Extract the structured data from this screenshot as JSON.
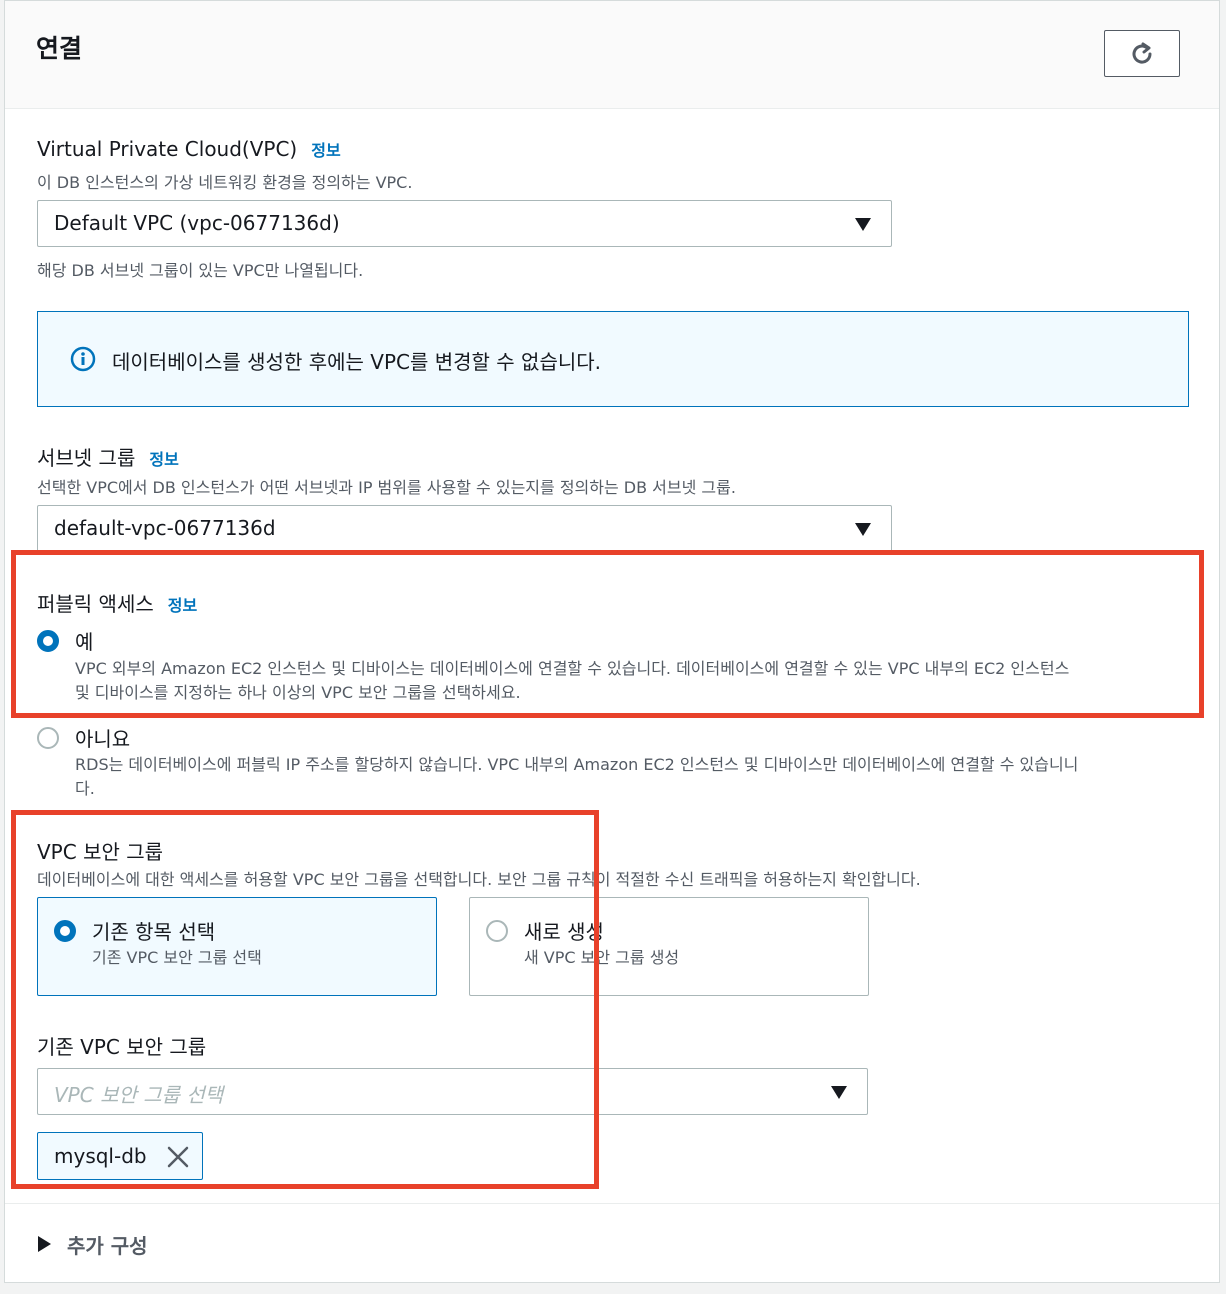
{
  "header": {
    "title": "연결"
  },
  "vpc": {
    "label": "Virtual Private Cloud(VPC)",
    "info": "정보",
    "description": "이 DB 인스턴스의 가상 네트워킹 환경을 정의하는 VPC.",
    "value": "Default VPC (vpc-0677136d)",
    "hint": "해당 DB 서브넷 그룹이 있는 VPC만 나열됩니다."
  },
  "alert": {
    "text": "데이터베이스를 생성한 후에는 VPC를 변경할 수 없습니다."
  },
  "subnet": {
    "label": "서브넷 그룹",
    "info": "정보",
    "description": "선택한 VPC에서 DB 인스턴스가 어떤 서브넷과 IP 범위를 사용할 수 있는지를 정의하는 DB 서브넷 그룹.",
    "value": "default-vpc-0677136d"
  },
  "public_access": {
    "label": "퍼블릭 액세스",
    "info": "정보",
    "options": [
      {
        "label": "예",
        "desc_line1": "VPC 외부의 Amazon EC2 인스턴스 및 디바이스는 데이터베이스에 연결할 수 있습니다. 데이터베이스에 연결할 수 있는 VPC 내부의 EC2 인스턴스",
        "desc_line2": "및 디바이스를 지정하는 하나 이상의 VPC 보안 그룹을 선택하세요."
      },
      {
        "label": "아니요",
        "desc_line1": "RDS는 데이터베이스에 퍼블릭 IP 주소를 할당하지 않습니다. VPC 내부의 Amazon EC2 인스턴스 및 디바이스만 데이터베이스에 연결할 수 있습니니",
        "desc_line2": "다."
      }
    ]
  },
  "security_group": {
    "label": "VPC 보안 그룹",
    "description": "데이터베이스에 대한 액세스를 허용할 VPC 보안 그룹을 선택합니다. 보안 그룹 규칙이 적절한 수신 트래픽을 허용하는지 확인합니다.",
    "tiles": [
      {
        "label": "기존 항목 선택",
        "desc": "기존 VPC 보안 그룹 선택"
      },
      {
        "label": "새로 생성",
        "desc": "새 VPC 보안 그룹 생성"
      }
    ],
    "existing_label": "기존 VPC 보안 그룹",
    "placeholder": "VPC 보안 그룹 선택",
    "token": "mysql-db"
  },
  "additional": {
    "label": "추가 구성"
  },
  "colors": {
    "accent": "#0073bb",
    "highlight": "#e8412a",
    "text": "#16191f",
    "muted": "#545b64"
  }
}
